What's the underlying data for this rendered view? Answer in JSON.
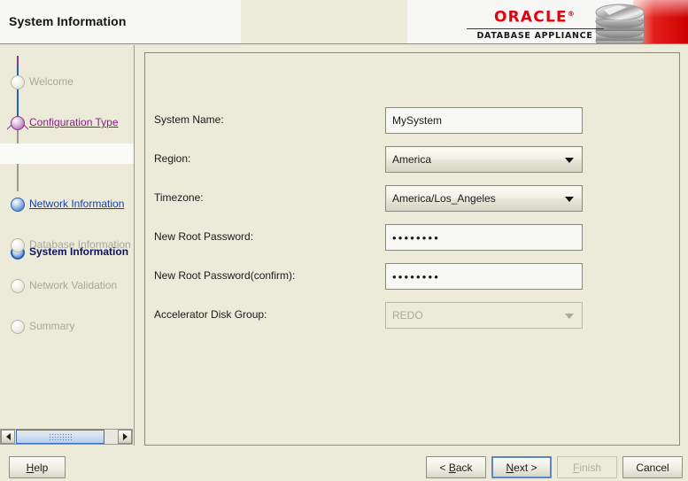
{
  "header": {
    "title": "System Information",
    "logo": {
      "brand": "ORACLE",
      "registered": "®",
      "product": "DATABASE APPLIANCE",
      "icon": "database-cylinder-icon",
      "accent_color": "#e4000f"
    }
  },
  "sidebar": {
    "steps": [
      {
        "label": "Welcome",
        "state": "disabled",
        "marker": "gray-circle"
      },
      {
        "label": "Configuration Type",
        "state": "visited",
        "marker": "purple-circle"
      },
      {
        "label": "System Information",
        "state": "current",
        "marker": "blue-ring-circle"
      },
      {
        "label": "Network Information",
        "state": "link",
        "marker": "blue-circle"
      },
      {
        "label": "Database Information",
        "state": "disabled",
        "marker": "gray-circle"
      },
      {
        "label": "Network Validation",
        "state": "disabled",
        "marker": "gray-circle"
      },
      {
        "label": "Summary",
        "state": "disabled",
        "marker": "gray-circle"
      }
    ],
    "scrollbar": {
      "left_arrow": "left-arrow-icon",
      "right_arrow": "right-arrow-icon"
    }
  },
  "form": {
    "fields": [
      {
        "label": "System Name:",
        "type": "text",
        "value": "MySystem",
        "enabled": true
      },
      {
        "label": "Region:",
        "type": "combo",
        "value": "America",
        "enabled": true
      },
      {
        "label": "Timezone:",
        "type": "combo",
        "value": "America/Los_Angeles",
        "enabled": true
      },
      {
        "label": "New Root Password:",
        "type": "password",
        "value": "••••••••",
        "enabled": true
      },
      {
        "label": "New Root Password(confirm):",
        "type": "password",
        "value": "••••••••",
        "enabled": true
      },
      {
        "label": "Accelerator Disk Group:",
        "type": "combo",
        "value": "REDO",
        "enabled": false
      }
    ]
  },
  "footer": {
    "help": {
      "label": "Help",
      "mnemonic": "H",
      "enabled": true
    },
    "back": {
      "label": "< Back",
      "mnemonic": "B",
      "enabled": true
    },
    "next": {
      "label": "Next >",
      "mnemonic": "N",
      "enabled": true,
      "focused": true
    },
    "finish": {
      "label": "Finish",
      "mnemonic": "F",
      "enabled": false
    },
    "cancel": {
      "label": "Cancel",
      "mnemonic": "",
      "enabled": true
    }
  }
}
